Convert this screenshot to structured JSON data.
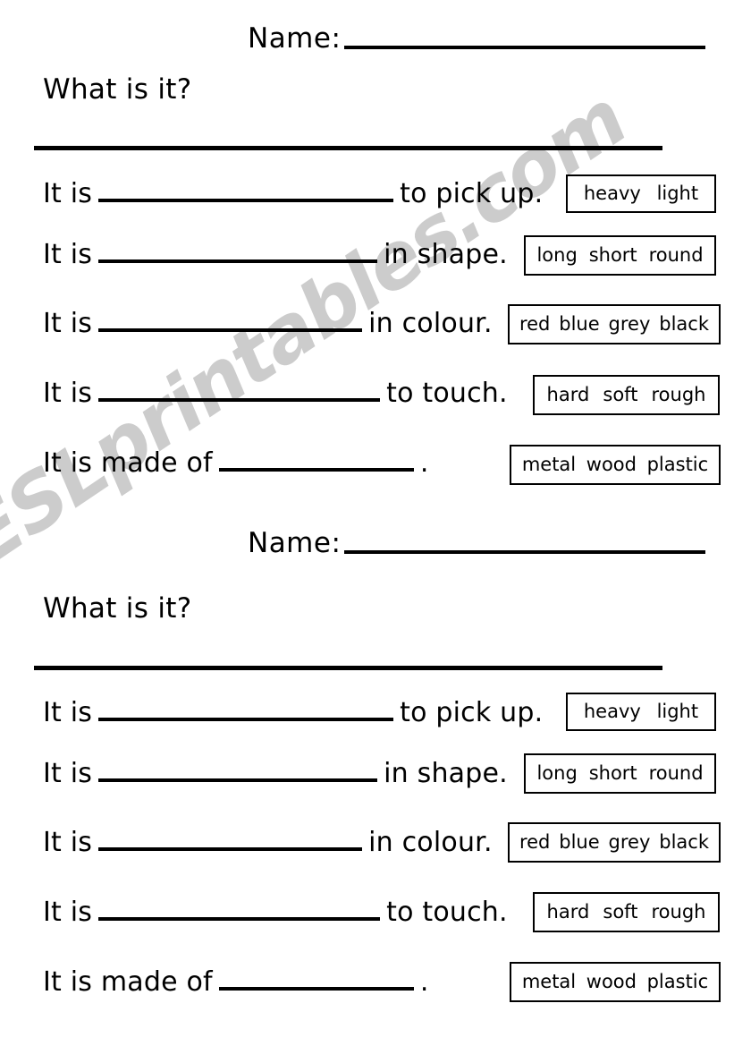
{
  "watermark": {
    "text": "ESLprintables.com",
    "color": "#cccccc"
  },
  "worksheet": {
    "title": "What is it?",
    "name_label": "Name:",
    "sections": [
      {
        "name_label": "Name:",
        "title": "What is it?",
        "rows": [
          {
            "lead": "It is",
            "tail": "to pick up.",
            "options": [
              "heavy",
              "light"
            ]
          },
          {
            "lead": "It is",
            "tail": "in shape.",
            "options": [
              "long",
              "short",
              "round"
            ]
          },
          {
            "lead": "It is",
            "tail": "in colour.",
            "options": [
              "red",
              "blue",
              "grey",
              "black"
            ]
          },
          {
            "lead": "It is",
            "tail": "to touch.",
            "options": [
              "hard",
              "soft",
              "rough"
            ]
          },
          {
            "lead": "It is made of",
            "tail": ".",
            "options": [
              "metal",
              "wood",
              "plastic"
            ]
          }
        ]
      },
      {
        "name_label": "Name:",
        "title": "What is it?",
        "rows": [
          {
            "lead": "It is",
            "tail": "to pick up.",
            "options": [
              "heavy",
              "light"
            ]
          },
          {
            "lead": "It is",
            "tail": "in shape.",
            "options": [
              "long",
              "short",
              "round"
            ]
          },
          {
            "lead": "It is",
            "tail": "in colour.",
            "options": [
              "red",
              "blue",
              "grey",
              "black"
            ]
          },
          {
            "lead": "It is",
            "tail": "to touch.",
            "options": [
              "hard",
              "soft",
              "rough"
            ]
          },
          {
            "lead": "It is made of",
            "tail": ".",
            "options": [
              "metal",
              "wood",
              "plastic"
            ]
          }
        ]
      }
    ]
  }
}
